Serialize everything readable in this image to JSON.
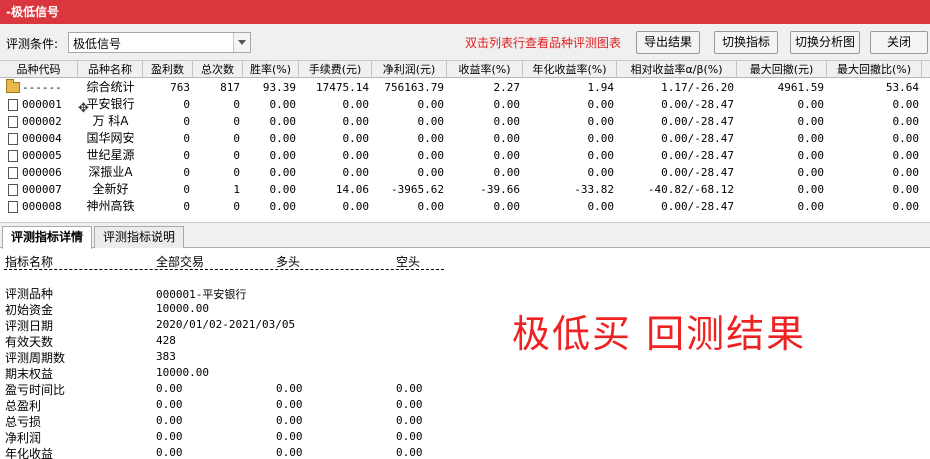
{
  "window": {
    "title": "-极低信号"
  },
  "toolbar": {
    "cond_label": "评测条件:",
    "cond_value": "极低信号",
    "hint": "双击列表行查看品种评测图表",
    "buttons": [
      "导出结果",
      "切换指标",
      "切换分析图",
      "关闭"
    ]
  },
  "table": {
    "columns": [
      "品种代码",
      "品种名称",
      "盈利数",
      "总次数",
      "胜率(%)",
      "手续费(元)",
      "净利润(元)",
      "收益率(%)",
      "年化收益率(%)",
      "相对收益率α/β(%)",
      "最大回撤(元)",
      "最大回撤比(%)"
    ],
    "rows": [
      {
        "icon": "folder-icon",
        "code": "------",
        "name": "综合统计",
        "cells": [
          "763",
          "817",
          "93.39",
          "17475.14",
          "756163.79",
          "2.27",
          "1.94",
          "1.17/-26.20",
          "4961.59",
          "53.64"
        ]
      },
      {
        "icon": "document-icon",
        "code": "000001",
        "name": "平安银行",
        "cells": [
          "0",
          "0",
          "0.00",
          "0.00",
          "0.00",
          "0.00",
          "0.00",
          "0.00/-28.47",
          "0.00",
          "0.00"
        ]
      },
      {
        "icon": "document-icon",
        "code": "000002",
        "name": "万 科A",
        "cells": [
          "0",
          "0",
          "0.00",
          "0.00",
          "0.00",
          "0.00",
          "0.00",
          "0.00/-28.47",
          "0.00",
          "0.00"
        ]
      },
      {
        "icon": "document-icon",
        "code": "000004",
        "name": "国华网安",
        "cells": [
          "0",
          "0",
          "0.00",
          "0.00",
          "0.00",
          "0.00",
          "0.00",
          "0.00/-28.47",
          "0.00",
          "0.00"
        ]
      },
      {
        "icon": "document-icon",
        "code": "000005",
        "name": "世纪星源",
        "cells": [
          "0",
          "0",
          "0.00",
          "0.00",
          "0.00",
          "0.00",
          "0.00",
          "0.00/-28.47",
          "0.00",
          "0.00"
        ]
      },
      {
        "icon": "document-icon",
        "code": "000006",
        "name": "深振业A",
        "cells": [
          "0",
          "0",
          "0.00",
          "0.00",
          "0.00",
          "0.00",
          "0.00",
          "0.00/-28.47",
          "0.00",
          "0.00"
        ]
      },
      {
        "icon": "document-icon",
        "code": "000007",
        "name": "全新好",
        "cells": [
          "0",
          "1",
          "0.00",
          "14.06",
          "-3965.62",
          "-39.66",
          "-33.82",
          "-40.82/-68.12",
          "0.00",
          "0.00"
        ]
      },
      {
        "icon": "document-icon",
        "code": "000008",
        "name": "神州高铁",
        "cells": [
          "0",
          "0",
          "0.00",
          "0.00",
          "0.00",
          "0.00",
          "0.00",
          "0.00/-28.47",
          "0.00",
          "0.00"
        ]
      }
    ]
  },
  "tabs": [
    "评测指标详情",
    "评测指标说明"
  ],
  "detail": {
    "headers": [
      "指标名称",
      "全部交易",
      "多头",
      "空头"
    ],
    "info": [
      {
        "label": "评测品种",
        "value": "000001-平安银行"
      },
      {
        "label": "初始资金",
        "value": "10000.00"
      },
      {
        "label": "评测日期",
        "value": "2020/01/02-2021/03/05"
      },
      {
        "label": "有效天数",
        "value": "428"
      },
      {
        "label": "评测周期数",
        "value": "383"
      },
      {
        "label": "期末权益",
        "value": "10000.00"
      }
    ],
    "metrics": [
      {
        "label": "盈亏时间比",
        "values": [
          "0.00",
          "0.00",
          "0.00"
        ]
      },
      {
        "label": "总盈利",
        "values": [
          "0.00",
          "0.00",
          "0.00"
        ]
      },
      {
        "label": "总亏损",
        "values": [
          "0.00",
          "0.00",
          "0.00"
        ]
      },
      {
        "label": "净利润",
        "values": [
          "0.00",
          "0.00",
          "0.00"
        ]
      },
      {
        "label": "年化收益",
        "values": [
          "0.00",
          "0.00",
          "0.00"
        ]
      }
    ]
  },
  "overlay": {
    "text": "极低买  回测结果",
    "color": "#e22222"
  }
}
